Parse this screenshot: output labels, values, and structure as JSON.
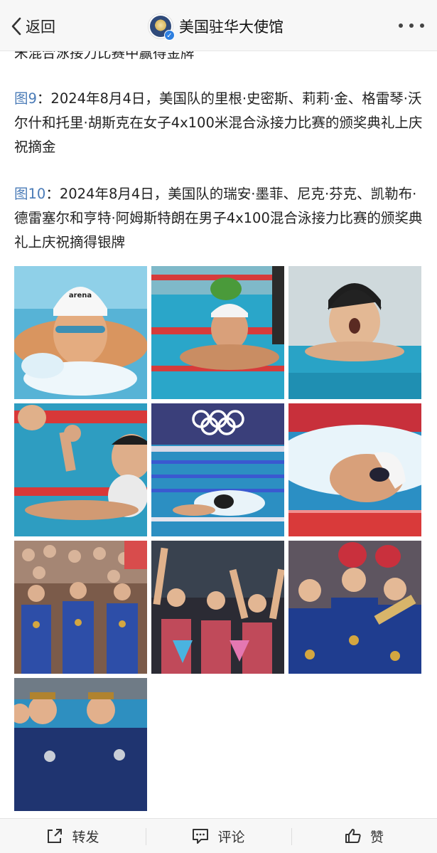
{
  "header": {
    "back_label": "返回",
    "account_name": "美国驻华大使馆",
    "verified_mark": "✓"
  },
  "content": {
    "cut_line": "米混合泳接力比赛中赢得金牌",
    "paragraphs": [
      {
        "fig": "图9",
        "text": "：2024年8月4日，美国队的里根·史密斯、莉莉·金、格雷琴·沃尔什和托里·胡斯克在女子4x100米混合泳接力比赛的颁奖典礼上庆祝摘金"
      },
      {
        "fig": "图10",
        "text": "：2024年8月4日，美国队的瑞安·墨菲、尼克·芬克、凯勒布·德雷塞尔和亨特·阿姆斯特朗在男子4x100混合泳接力比赛的颁奖典礼上庆祝摘得银牌"
      }
    ],
    "photos": [
      {
        "name": "photo-swimmer-breaststroke",
        "caption": "arena"
      },
      {
        "name": "photo-swimmer-celebrating-lane"
      },
      {
        "name": "photo-swimmer-surprised"
      },
      {
        "name": "photo-swimmers-cheering-lane"
      },
      {
        "name": "photo-olympic-pool-race"
      },
      {
        "name": "photo-swimmer-freestyle-splash"
      },
      {
        "name": "photo-team-medals-crowd"
      },
      {
        "name": "photo-women-team-arms-raised"
      },
      {
        "name": "photo-women-medalists-mascots"
      },
      {
        "name": "photo-men-silver-medalists"
      }
    ]
  },
  "footer": {
    "share_label": "转发",
    "comment_label": "评论",
    "like_label": "赞"
  },
  "colors": {
    "link_blue": "#4a7bb7",
    "text": "#222222",
    "bar_bg": "#f7f7f7"
  },
  "icons": {
    "back": "chevron-left-icon",
    "more": "more-dots-icon",
    "share": "share-icon",
    "comment": "comment-icon",
    "like": "thumbs-up-icon"
  }
}
